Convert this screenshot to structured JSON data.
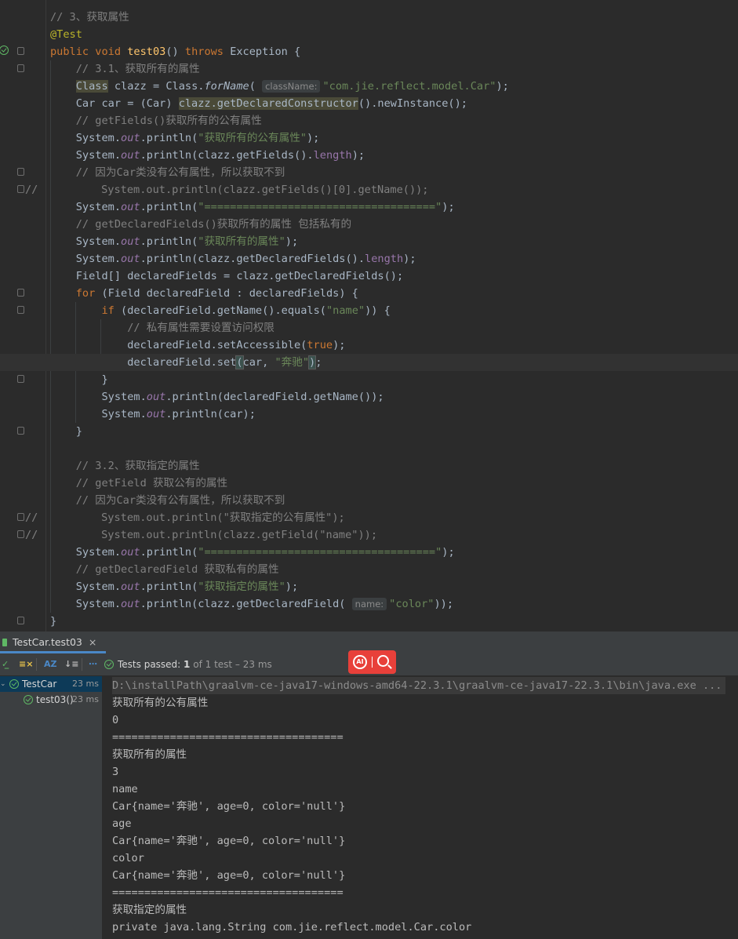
{
  "editor": {
    "lines": [
      {
        "code": [
          {
            "t": "// 3、获取属性",
            "c": "c"
          }
        ]
      },
      {
        "code": [
          {
            "t": "@Test",
            "c": "an"
          }
        ]
      },
      {
        "code": [
          {
            "t": "public ",
            "c": "k"
          },
          {
            "t": "void ",
            "c": "k"
          },
          {
            "t": "test03",
            "c": "fn"
          },
          {
            "t": "() "
          },
          {
            "t": "throws ",
            "c": "k"
          },
          {
            "t": "Exception {"
          }
        ]
      },
      {
        "code": [
          {
            "t": "    "
          },
          {
            "t": "// 3.1、获取所有的属性",
            "c": "c"
          }
        ]
      },
      {
        "code": [
          {
            "t": "    "
          },
          {
            "t": "Class",
            "c": "hlbg"
          },
          {
            "t": " clazz = Class."
          },
          {
            "t": "forName",
            "c": "it"
          },
          {
            "t": "( "
          },
          {
            "hint": "className:"
          },
          {
            "t": "\"com.jie.reflect.model.Car\"",
            "c": "s"
          },
          {
            "t": ");"
          }
        ]
      },
      {
        "code": [
          {
            "t": "    Car car = (Car) "
          },
          {
            "t": "clazz.getDeclaredConstructor",
            "c": "hlbg"
          },
          {
            "t": "().newInstance();"
          }
        ]
      },
      {
        "code": [
          {
            "t": "    "
          },
          {
            "t": "// getFields()获取所有的公有属性",
            "c": "c"
          }
        ]
      },
      {
        "code": [
          {
            "t": "    System."
          },
          {
            "t": "out",
            "c": "st"
          },
          {
            "t": ".println("
          },
          {
            "t": "\"获取所有的公有属性\"",
            "c": "s"
          },
          {
            "t": ");"
          }
        ]
      },
      {
        "code": [
          {
            "t": "    System."
          },
          {
            "t": "out",
            "c": "st"
          },
          {
            "t": ".println(clazz.getFields()."
          },
          {
            "t": "length",
            "c": "fld"
          },
          {
            "t": ");"
          }
        ]
      },
      {
        "code": [
          {
            "t": "    "
          },
          {
            "t": "// 因为Car类没有公有属性，所以获取不到",
            "c": "c"
          }
        ]
      },
      {
        "code": [
          {
            "t": "      System.out.println(clazz.getFields()[0].getName());",
            "c": "c"
          }
        ],
        "prefix": "//"
      },
      {
        "code": [
          {
            "t": "    System."
          },
          {
            "t": "out",
            "c": "st"
          },
          {
            "t": ".println("
          },
          {
            "t": "\"====================================\"",
            "c": "s"
          },
          {
            "t": ");"
          }
        ]
      },
      {
        "code": [
          {
            "t": "    "
          },
          {
            "t": "// getDeclaredFields()获取所有的属性 包括私有的",
            "c": "c"
          }
        ]
      },
      {
        "code": [
          {
            "t": "    System."
          },
          {
            "t": "out",
            "c": "st"
          },
          {
            "t": ".println("
          },
          {
            "t": "\"获取所有的属性\"",
            "c": "s"
          },
          {
            "t": ");"
          }
        ]
      },
      {
        "code": [
          {
            "t": "    System."
          },
          {
            "t": "out",
            "c": "st"
          },
          {
            "t": ".println(clazz.getDeclaredFields()."
          },
          {
            "t": "length",
            "c": "fld"
          },
          {
            "t": ");"
          }
        ]
      },
      {
        "code": [
          {
            "t": "    Field[] declaredFields = clazz.getDeclaredFields();"
          }
        ]
      },
      {
        "code": [
          {
            "t": "    "
          },
          {
            "t": "for ",
            "c": "k"
          },
          {
            "t": "(Field declaredField : declaredFields) {"
          }
        ]
      },
      {
        "code": [
          {
            "t": "        "
          },
          {
            "t": "if ",
            "c": "k"
          },
          {
            "t": "(declaredField.getName().equals("
          },
          {
            "t": "\"name\"",
            "c": "s"
          },
          {
            "t": ")) {"
          }
        ]
      },
      {
        "code": [
          {
            "t": "            "
          },
          {
            "t": "// 私有属性需要设置访问权限",
            "c": "c"
          }
        ]
      },
      {
        "code": [
          {
            "t": "            declaredField.setAccessible("
          },
          {
            "t": "true",
            "c": "k"
          },
          {
            "t": ");"
          }
        ]
      },
      {
        "code": [
          {
            "t": "            declaredField.set"
          },
          {
            "t": "(",
            "c": "bm"
          },
          {
            "t": "car, "
          },
          {
            "t": "\"奔驰\"",
            "c": "s"
          },
          {
            "t": ")",
            "c": "bm"
          },
          {
            "t": ";"
          }
        ],
        "current": true
      },
      {
        "code": [
          {
            "t": "        }"
          }
        ]
      },
      {
        "code": [
          {
            "t": "        System."
          },
          {
            "t": "out",
            "c": "st"
          },
          {
            "t": ".println(declaredField.getName());"
          }
        ]
      },
      {
        "code": [
          {
            "t": "        System."
          },
          {
            "t": "out",
            "c": "st"
          },
          {
            "t": ".println(car);"
          }
        ]
      },
      {
        "code": [
          {
            "t": "    }"
          }
        ]
      },
      {
        "code": []
      },
      {
        "code": [
          {
            "t": "    "
          },
          {
            "t": "// 3.2、获取指定的属性",
            "c": "c"
          }
        ]
      },
      {
        "code": [
          {
            "t": "    "
          },
          {
            "t": "// getField 获取公有的属性",
            "c": "c"
          }
        ]
      },
      {
        "code": [
          {
            "t": "    "
          },
          {
            "t": "// 因为Car类没有公有属性，所以获取不到",
            "c": "c"
          }
        ]
      },
      {
        "code": [
          {
            "t": "      System.out.println(\"获取指定的公有属性\");",
            "c": "c"
          }
        ],
        "prefix": "//"
      },
      {
        "code": [
          {
            "t": "      System.out.println(clazz.getField(\"name\"));",
            "c": "c"
          }
        ],
        "prefix": "//"
      },
      {
        "code": [
          {
            "t": "    System."
          },
          {
            "t": "out",
            "c": "st"
          },
          {
            "t": ".println("
          },
          {
            "t": "\"====================================\"",
            "c": "s"
          },
          {
            "t": ");"
          }
        ]
      },
      {
        "code": [
          {
            "t": "    "
          },
          {
            "t": "// getDeclaredField 获取私有的属性",
            "c": "c"
          }
        ]
      },
      {
        "code": [
          {
            "t": "    System."
          },
          {
            "t": "out",
            "c": "st"
          },
          {
            "t": ".println("
          },
          {
            "t": "\"获取指定的属性\"",
            "c": "s"
          },
          {
            "t": ");"
          }
        ]
      },
      {
        "code": [
          {
            "t": "    System."
          },
          {
            "t": "out",
            "c": "st"
          },
          {
            "t": ".println(clazz.getDeclaredField( "
          },
          {
            "hint": "name:"
          },
          {
            "t": "\"color\"",
            "c": "s"
          },
          {
            "t": "));"
          }
        ]
      },
      {
        "code": [
          {
            "t": "}"
          }
        ]
      }
    ]
  },
  "run_panel": {
    "tab_label": "TestCar.test03",
    "tab_close": "×",
    "toolbar": {
      "passed_label": "Tests passed:",
      "passed_count": "1",
      "passed_detail": "of 1 test – 23 ms"
    },
    "tree": [
      {
        "label": "TestCar",
        "time": "23 ms"
      },
      {
        "label": "test03()",
        "time": "23 ms"
      }
    ],
    "console": [
      "D:\\installPath\\graalvm-ce-java17-windows-amd64-22.3.1\\graalvm-ce-java17-22.3.1\\bin\\java.exe ...",
      "获取所有的公有属性",
      "0",
      "====================================",
      "获取所有的属性",
      "3",
      "name",
      "Car{name='奔驰', age=0, color='null'}",
      "age",
      "Car{name='奔驰', age=0, color='null'}",
      "color",
      "Car{name='奔驰', age=0, color='null'}",
      "====================================",
      "获取指定的属性",
      "private java.lang.String com.jie.reflect.model.Car.color"
    ]
  },
  "ai_toolbar": {
    "ai_label": "AI"
  }
}
